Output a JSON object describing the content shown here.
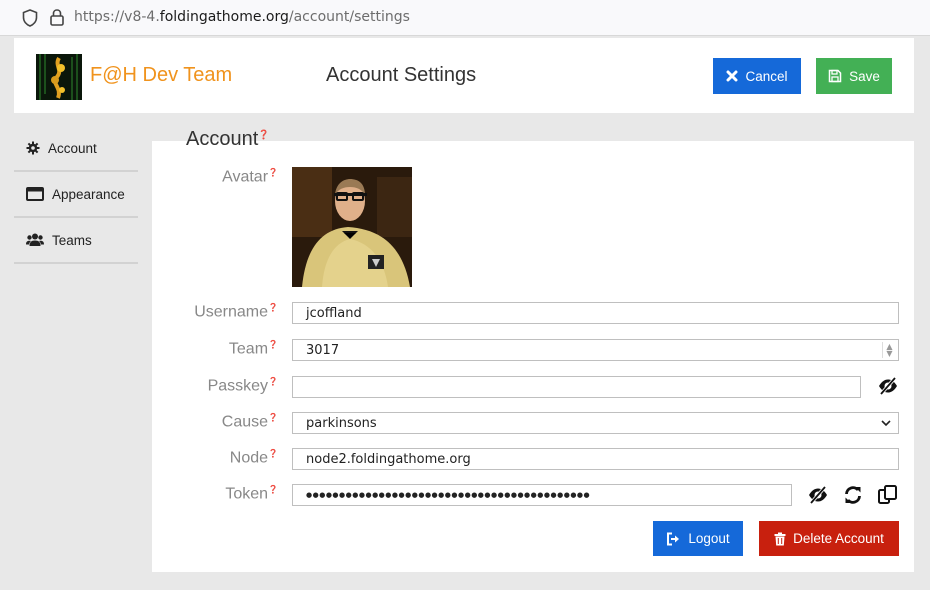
{
  "browser": {
    "url_prefix": "https://v8-4.",
    "url_host": "foldingathome.org",
    "url_path": "/account/settings",
    "icons": [
      "shield-icon",
      "lock-icon"
    ]
  },
  "header": {
    "team_name": "F@H Dev Team",
    "title": "Account Settings",
    "cancel_label": "Cancel",
    "save_label": "Save",
    "colors": {
      "team_name": "#f0931d",
      "cancel": "#1569d9",
      "save": "#43b055"
    }
  },
  "sidebar": {
    "items": [
      {
        "label": "Account",
        "icon": "gear-icon"
      },
      {
        "label": "Appearance",
        "icon": "window-icon"
      },
      {
        "label": "Teams",
        "icon": "users-icon"
      }
    ]
  },
  "section": {
    "title": "Account",
    "help": "❓"
  },
  "form": {
    "avatar_label": "Avatar",
    "username_label": "Username",
    "username_value": "jcoffland",
    "team_label": "Team",
    "team_value": "3017",
    "passkey_label": "Passkey",
    "passkey_value": "",
    "cause_label": "Cause",
    "cause_value": "parkinsons",
    "node_label": "Node",
    "node_value": "node2.foldingathome.org",
    "token_label": "Token",
    "token_value": "●●●●●●●●●●●●●●●●●●●●●●●●●●●●●●●●●●●●●●●●●●●"
  },
  "actions": {
    "logout_label": "Logout",
    "delete_label": "Delete Account",
    "colors": {
      "logout": "#1569d9",
      "delete": "#c8200e"
    }
  }
}
